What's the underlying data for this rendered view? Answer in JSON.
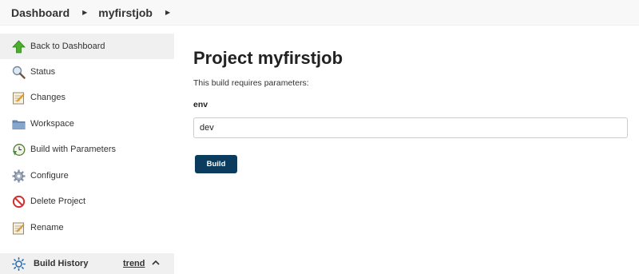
{
  "breadcrumb": {
    "items": [
      {
        "label": "Dashboard"
      },
      {
        "label": "myfirstjob"
      }
    ]
  },
  "sidebar": {
    "items": [
      {
        "label": "Back to Dashboard",
        "icon": "up-arrow-icon",
        "active": true
      },
      {
        "label": "Status",
        "icon": "magnifier-icon"
      },
      {
        "label": "Changes",
        "icon": "notepad-icon"
      },
      {
        "label": "Workspace",
        "icon": "folder-icon"
      },
      {
        "label": "Build with Parameters",
        "icon": "clock-build-icon"
      },
      {
        "label": "Configure",
        "icon": "gear-icon"
      },
      {
        "label": "Delete Project",
        "icon": "no-entry-icon"
      },
      {
        "label": "Rename",
        "icon": "notepad-icon"
      }
    ],
    "build_history": {
      "label": "Build History",
      "trend": "trend",
      "icon": "sun-icon"
    }
  },
  "main": {
    "title": "Project myfirstjob",
    "description": "This build requires parameters:",
    "parameter": {
      "name": "env",
      "value": "dev"
    },
    "build_button": "Build"
  },
  "colors": {
    "build_button": "#0b3c5d",
    "sidebar_active": "#f0f0f0",
    "breadcrumb_bg": "#f8f8f8"
  }
}
